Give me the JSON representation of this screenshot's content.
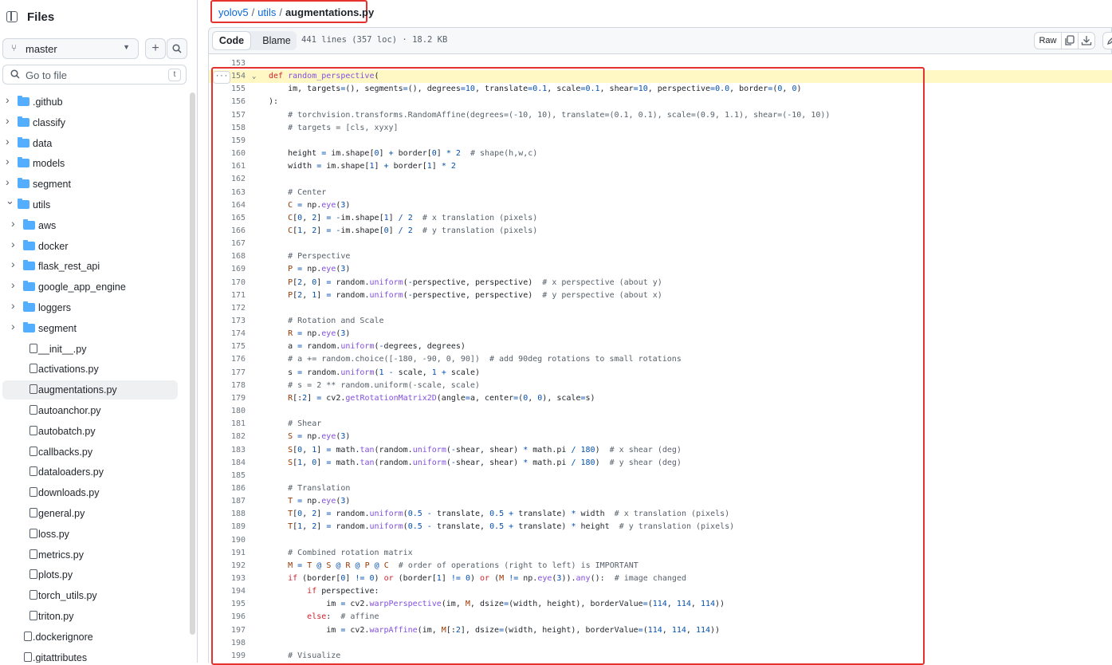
{
  "sidebar": {
    "title": "Files",
    "branch": "master",
    "goto_placeholder": "Go to file",
    "goto_shortcut": "t",
    "items": [
      {
        "label": ".github",
        "type": "folder",
        "depth": 0,
        "expanded": false
      },
      {
        "label": "classify",
        "type": "folder",
        "depth": 0,
        "expanded": false
      },
      {
        "label": "data",
        "type": "folder",
        "depth": 0,
        "expanded": false
      },
      {
        "label": "models",
        "type": "folder",
        "depth": 0,
        "expanded": false
      },
      {
        "label": "segment",
        "type": "folder",
        "depth": 0,
        "expanded": false
      },
      {
        "label": "utils",
        "type": "folder",
        "depth": 0,
        "expanded": true
      },
      {
        "label": "aws",
        "type": "folder",
        "depth": 1,
        "expanded": false
      },
      {
        "label": "docker",
        "type": "folder",
        "depth": 1,
        "expanded": false
      },
      {
        "label": "flask_rest_api",
        "type": "folder",
        "depth": 1,
        "expanded": false
      },
      {
        "label": "google_app_engine",
        "type": "folder",
        "depth": 1,
        "expanded": false
      },
      {
        "label": "loggers",
        "type": "folder",
        "depth": 1,
        "expanded": false
      },
      {
        "label": "segment",
        "type": "folder",
        "depth": 1,
        "expanded": false
      },
      {
        "label": "__init__.py",
        "type": "file",
        "depth": 1
      },
      {
        "label": "activations.py",
        "type": "file",
        "depth": 1
      },
      {
        "label": "augmentations.py",
        "type": "file",
        "depth": 1,
        "selected": true
      },
      {
        "label": "autoanchor.py",
        "type": "file",
        "depth": 1
      },
      {
        "label": "autobatch.py",
        "type": "file",
        "depth": 1
      },
      {
        "label": "callbacks.py",
        "type": "file",
        "depth": 1
      },
      {
        "label": "dataloaders.py",
        "type": "file",
        "depth": 1
      },
      {
        "label": "downloads.py",
        "type": "file",
        "depth": 1
      },
      {
        "label": "general.py",
        "type": "file",
        "depth": 1
      },
      {
        "label": "loss.py",
        "type": "file",
        "depth": 1
      },
      {
        "label": "metrics.py",
        "type": "file",
        "depth": 1
      },
      {
        "label": "plots.py",
        "type": "file",
        "depth": 1
      },
      {
        "label": "torch_utils.py",
        "type": "file",
        "depth": 1
      },
      {
        "label": "triton.py",
        "type": "file",
        "depth": 1
      },
      {
        "label": ".dockerignore",
        "type": "file",
        "depth": 0
      },
      {
        "label": ".gitattributes",
        "type": "file",
        "depth": 0
      }
    ]
  },
  "breadcrumb": {
    "repo": "yolov5",
    "dir": "utils",
    "separator": "/",
    "file": "augmentations.py"
  },
  "toolbar": {
    "code_tab": "Code",
    "blame_tab": "Blame",
    "file_info": "441 lines (357 loc) · 18.2 KB",
    "raw_label": "Raw"
  },
  "code": {
    "highlight_line": "154",
    "lines": [
      {
        "n": "153",
        "t": ""
      },
      {
        "n": "154",
        "t": "def random_perspective("
      },
      {
        "n": "155",
        "t": "    im, targets=(), segments=(), degrees=10, translate=0.1, scale=0.1, shear=10, perspective=0.0, border=(0, 0)"
      },
      {
        "n": "156",
        "t": "):"
      },
      {
        "n": "157",
        "t": "    # torchvision.transforms.RandomAffine(degrees=(-10, 10), translate=(0.1, 0.1), scale=(0.9, 1.1), shear=(-10, 10))"
      },
      {
        "n": "158",
        "t": "    # targets = [cls, xyxy]"
      },
      {
        "n": "159",
        "t": ""
      },
      {
        "n": "160",
        "t": "    height = im.shape[0] + border[0] * 2  # shape(h,w,c)"
      },
      {
        "n": "161",
        "t": "    width = im.shape[1] + border[1] * 2"
      },
      {
        "n": "162",
        "t": ""
      },
      {
        "n": "163",
        "t": "    # Center"
      },
      {
        "n": "164",
        "t": "    C = np.eye(3)"
      },
      {
        "n": "165",
        "t": "    C[0, 2] = -im.shape[1] / 2  # x translation (pixels)"
      },
      {
        "n": "166",
        "t": "    C[1, 2] = -im.shape[0] / 2  # y translation (pixels)"
      },
      {
        "n": "167",
        "t": ""
      },
      {
        "n": "168",
        "t": "    # Perspective"
      },
      {
        "n": "169",
        "t": "    P = np.eye(3)"
      },
      {
        "n": "170",
        "t": "    P[2, 0] = random.uniform(-perspective, perspective)  # x perspective (about y)"
      },
      {
        "n": "171",
        "t": "    P[2, 1] = random.uniform(-perspective, perspective)  # y perspective (about x)"
      },
      {
        "n": "172",
        "t": ""
      },
      {
        "n": "173",
        "t": "    # Rotation and Scale"
      },
      {
        "n": "174",
        "t": "    R = np.eye(3)"
      },
      {
        "n": "175",
        "t": "    a = random.uniform(-degrees, degrees)"
      },
      {
        "n": "176",
        "t": "    # a += random.choice([-180, -90, 0, 90])  # add 90deg rotations to small rotations"
      },
      {
        "n": "177",
        "t": "    s = random.uniform(1 - scale, 1 + scale)"
      },
      {
        "n": "178",
        "t": "    # s = 2 ** random.uniform(-scale, scale)"
      },
      {
        "n": "179",
        "t": "    R[:2] = cv2.getRotationMatrix2D(angle=a, center=(0, 0), scale=s)"
      },
      {
        "n": "180",
        "t": ""
      },
      {
        "n": "181",
        "t": "    # Shear"
      },
      {
        "n": "182",
        "t": "    S = np.eye(3)"
      },
      {
        "n": "183",
        "t": "    S[0, 1] = math.tan(random.uniform(-shear, shear) * math.pi / 180)  # x shear (deg)"
      },
      {
        "n": "184",
        "t": "    S[1, 0] = math.tan(random.uniform(-shear, shear) * math.pi / 180)  # y shear (deg)"
      },
      {
        "n": "185",
        "t": ""
      },
      {
        "n": "186",
        "t": "    # Translation"
      },
      {
        "n": "187",
        "t": "    T = np.eye(3)"
      },
      {
        "n": "188",
        "t": "    T[0, 2] = random.uniform(0.5 - translate, 0.5 + translate) * width  # x translation (pixels)"
      },
      {
        "n": "189",
        "t": "    T[1, 2] = random.uniform(0.5 - translate, 0.5 + translate) * height  # y translation (pixels)"
      },
      {
        "n": "190",
        "t": ""
      },
      {
        "n": "191",
        "t": "    # Combined rotation matrix"
      },
      {
        "n": "192",
        "t": "    M = T @ S @ R @ P @ C  # order of operations (right to left) is IMPORTANT"
      },
      {
        "n": "193",
        "t": "    if (border[0] != 0) or (border[1] != 0) or (M != np.eye(3)).any():  # image changed"
      },
      {
        "n": "194",
        "t": "        if perspective:"
      },
      {
        "n": "195",
        "t": "            im = cv2.warpPerspective(im, M, dsize=(width, height), borderValue=(114, 114, 114))"
      },
      {
        "n": "196",
        "t": "        else:  # affine"
      },
      {
        "n": "197",
        "t": "            im = cv2.warpAffine(im, M[:2], dsize=(width, height), borderValue=(114, 114, 114))"
      },
      {
        "n": "198",
        "t": ""
      },
      {
        "n": "199",
        "t": "    # Visualize"
      }
    ]
  },
  "colors": {
    "link": "#0969da",
    "keyword": "#cf222e",
    "function": "#8250df",
    "number": "#0550ae",
    "comment": "#57606a",
    "constant": "#953800",
    "highlight": "#fff8c5",
    "annotation_box": "#e5322d",
    "folder": "#54aeff"
  }
}
